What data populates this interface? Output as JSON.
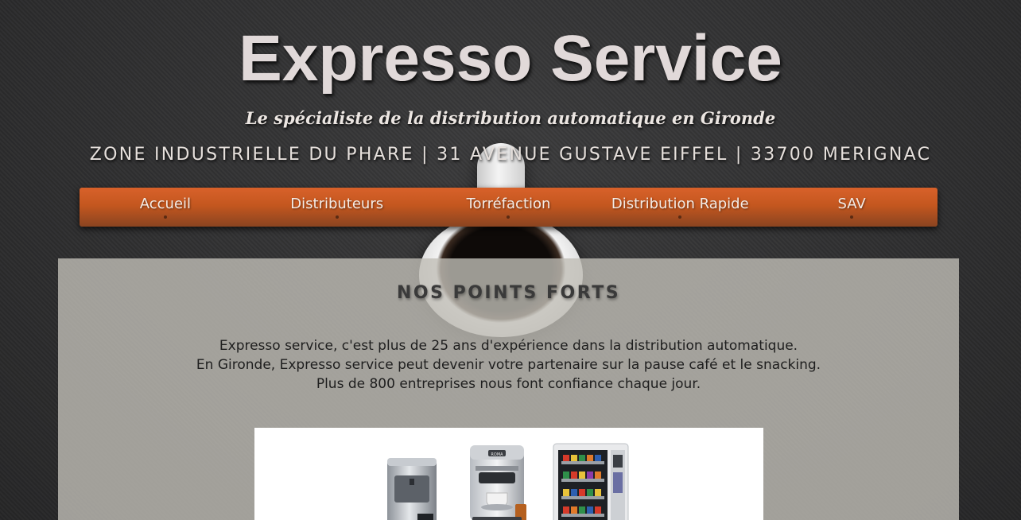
{
  "header": {
    "title": "Expresso Service",
    "tagline": "Le spécialiste de la distribution automatique en Gironde",
    "address": "ZONE INDUSTRIELLE DU PHARE | 31 AVENUE GUSTAVE EIFFEL | 33700 MERIGNAC"
  },
  "nav": {
    "items": [
      {
        "label": "Accueil"
      },
      {
        "label": "Distributeurs"
      },
      {
        "label": "Torréfaction"
      },
      {
        "label": "Distribution Rapide"
      },
      {
        "label": "SAV"
      }
    ]
  },
  "main": {
    "section_title": "NOS POINTS FORTS",
    "intro_lines": [
      "Expresso service, c'est plus de 25 ans d'expérience dans la distribution automatique.",
      "En Gironde, Expresso service peut devenir votre partenaire sur la pause café et le snacking.",
      "Plus de 800 entreprises nous font confiance chaque jour."
    ],
    "product_images": [
      {
        "icon": "water-dispenser-image"
      },
      {
        "icon": "espresso-machine-image",
        "brand_text": "ROMA"
      },
      {
        "icon": "snack-vending-machine-image"
      }
    ]
  },
  "colors": {
    "nav_orange": "#d8612a",
    "title_text": "#e1d9d9",
    "panel_bg": "#c0beb6"
  }
}
